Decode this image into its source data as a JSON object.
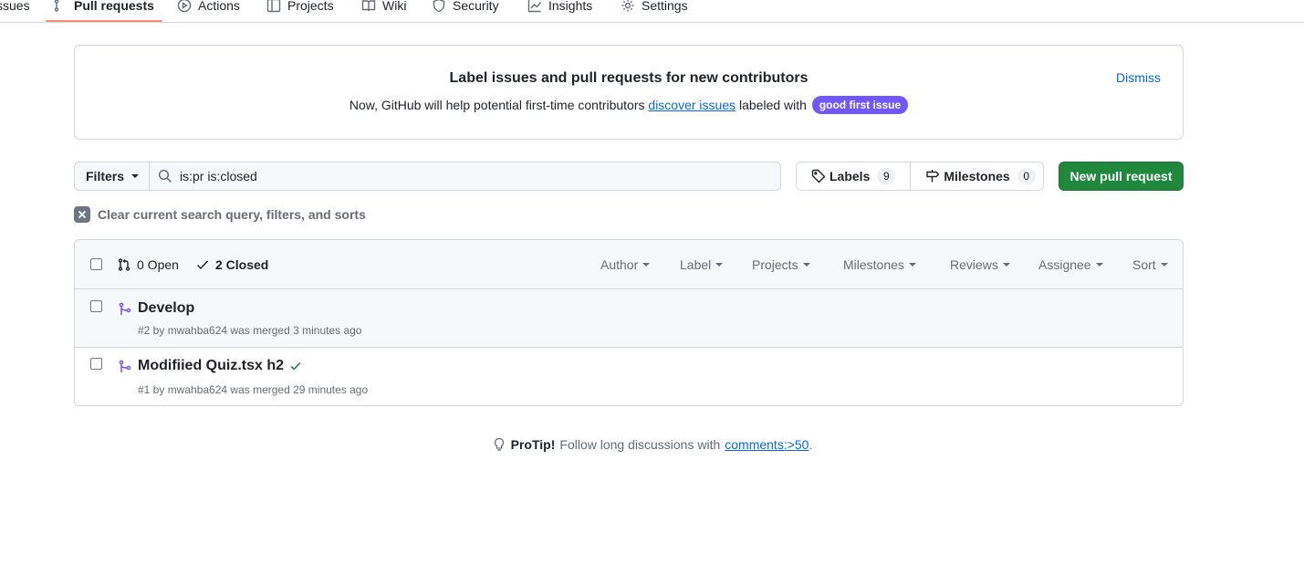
{
  "nav": {
    "items": [
      {
        "label": "ssues",
        "icon": "issue-icon"
      },
      {
        "label": "Pull requests",
        "icon": "git-pull-request-icon"
      },
      {
        "label": "Actions",
        "icon": "play-icon"
      },
      {
        "label": "Projects",
        "icon": "table-icon"
      },
      {
        "label": "Wiki",
        "icon": "book-icon"
      },
      {
        "label": "Security",
        "icon": "shield-icon"
      },
      {
        "label": "Insights",
        "icon": "graph-icon"
      },
      {
        "label": "Settings",
        "icon": "gear-icon"
      }
    ],
    "active": "Pull requests"
  },
  "banner": {
    "title": "Label issues and pull requests for new contributors",
    "text_before": "Now, GitHub will help potential first-time contributors",
    "link": "discover issues",
    "text_after": "labeled with",
    "label": "good first issue",
    "label_color": "#7057ff",
    "dismiss": "Dismiss"
  },
  "filters": {
    "button": "Filters",
    "search_value": "is:pr is:closed",
    "labels": {
      "label": "Labels",
      "count": "9"
    },
    "milestones": {
      "label": "Milestones",
      "count": "0"
    },
    "new_pr": "New pull request",
    "clear": "Clear current search query, filters, and sorts"
  },
  "list": {
    "open": "0 Open",
    "closed": "2 Closed",
    "sorts": [
      "Author",
      "Label",
      "Projects",
      "Milestones",
      "Reviews",
      "Assignee",
      "Sort"
    ],
    "rows": [
      {
        "title": "Develop",
        "meta": "#2 by mwahba624 was merged 3 minutes ago",
        "check": false
      },
      {
        "title": "Modifiied Quiz.tsx h2",
        "meta": "#1 by mwahba624 was merged 29 minutes ago",
        "check": true
      }
    ]
  },
  "protip": {
    "lead": "ProTip!",
    "text": "Follow long discussions with",
    "link": "comments:>50",
    "end": "."
  },
  "colors": {
    "merged": "#8250df",
    "success": "#1a7f37",
    "primary_button": "#1f883d",
    "link": "#0969da",
    "nav_underline": "#fd8c73"
  }
}
